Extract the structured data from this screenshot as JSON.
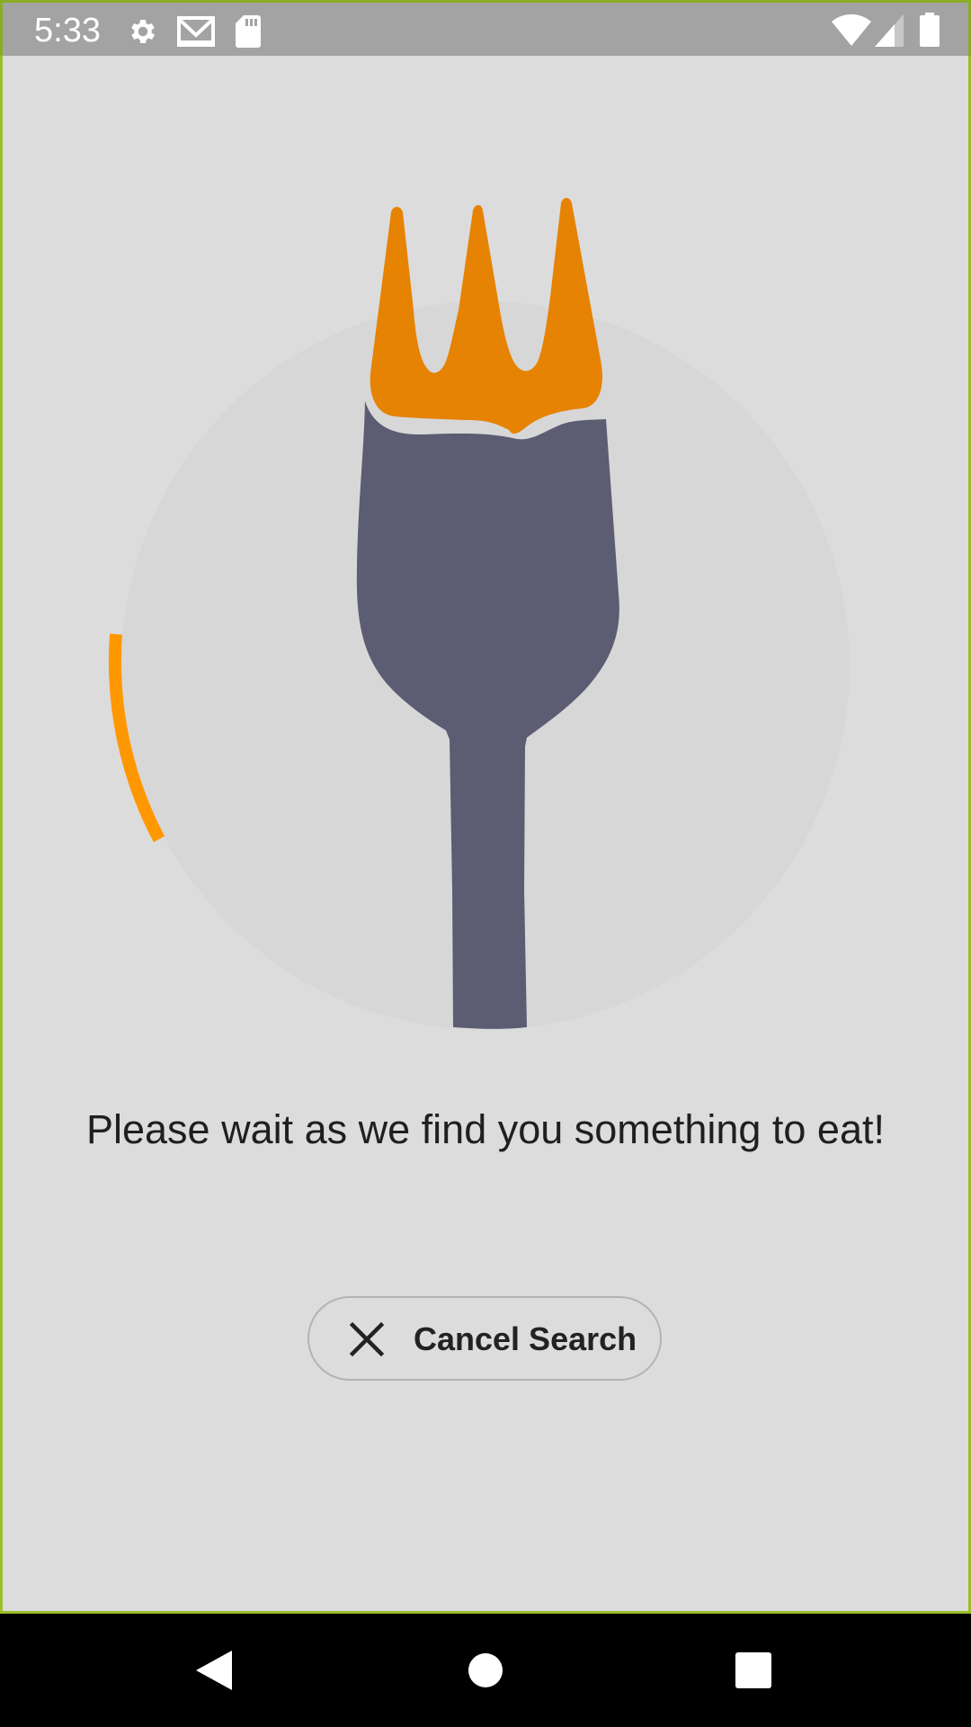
{
  "status_bar": {
    "time": "5:33",
    "icons_left": [
      "gear-icon",
      "gmail-icon",
      "sd-card-icon"
    ],
    "icons_right": [
      "wifi-icon",
      "signal-icon",
      "battery-icon"
    ]
  },
  "loading": {
    "message": "Please wait as we find you something to eat!",
    "spinner_color": "#ff9800",
    "illustration": "fork-icon",
    "fork_tines_color": "#e68303",
    "fork_body_color": "#5c5c72",
    "plate_color": "#d7d7d8"
  },
  "cancel_button": {
    "icon": "close-icon",
    "label": "Cancel Search"
  },
  "nav_bar": {
    "buttons": [
      "back-button",
      "home-button",
      "recents-button"
    ]
  },
  "colors": {
    "background": "#dcdcdd",
    "status_bar": "#a3a3a3",
    "accent": "#ff9800"
  }
}
